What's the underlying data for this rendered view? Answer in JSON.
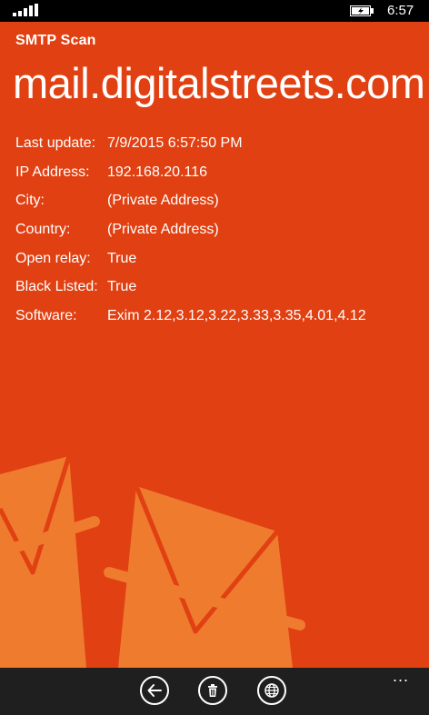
{
  "status_bar": {
    "time": "6:57"
  },
  "app": {
    "name": "SMTP Scan"
  },
  "host": {
    "name": "mail.digitalstreets.com"
  },
  "details": [
    {
      "label": "Last update:",
      "value": "7/9/2015 6:57:50 PM"
    },
    {
      "label": "IP Address:",
      "value": "192.168.20.116"
    },
    {
      "label": "City:",
      "value": "(Private Address)"
    },
    {
      "label": "Country:",
      "value": "(Private Address)"
    },
    {
      "label": "Open relay:",
      "value": "True"
    },
    {
      "label": "Black Listed:",
      "value": "True"
    },
    {
      "label": "Software:",
      "value": "Exim 2.12,3.12,3.22,3.33,3.35,4.01,4.12"
    }
  ],
  "app_bar": {
    "buttons": [
      {
        "icon": "back-arrow-icon"
      },
      {
        "icon": "trash-icon"
      },
      {
        "icon": "globe-icon"
      }
    ],
    "more": "..."
  },
  "colors": {
    "accent": "#E14012",
    "art": "#EE7B2E",
    "status_bar": "#000000",
    "app_bar": "#1F1F1F"
  }
}
